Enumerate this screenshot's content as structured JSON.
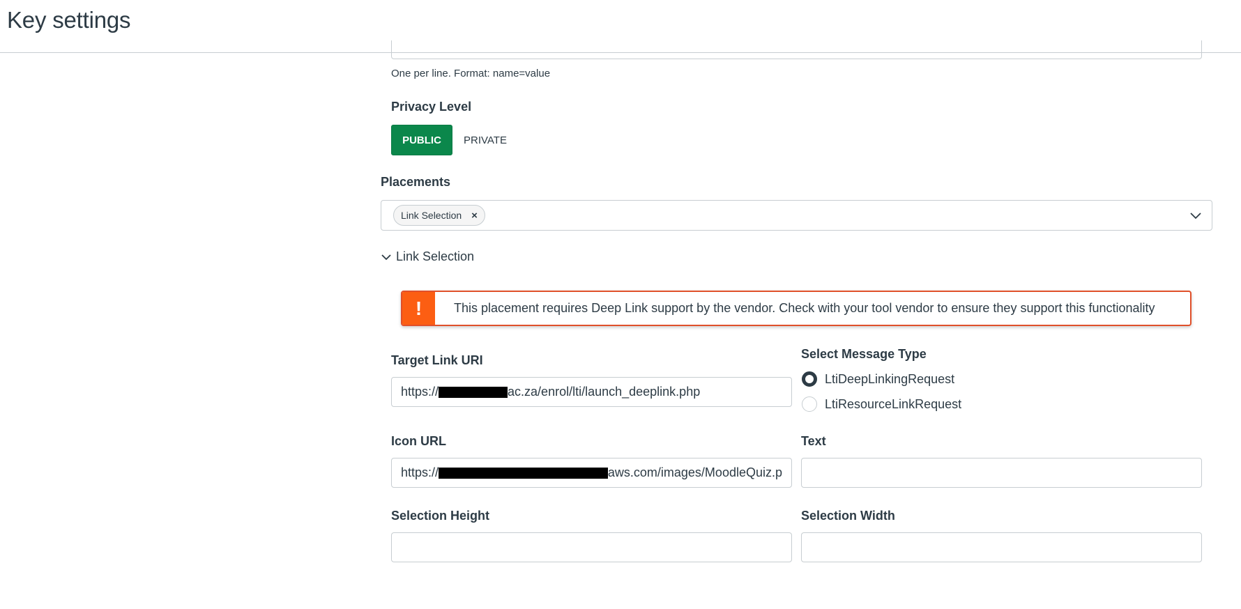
{
  "header": {
    "title": "Key settings"
  },
  "custom_fields": {
    "hint": "One per line. Format: name=value"
  },
  "privacy": {
    "label": "Privacy Level",
    "options": [
      "PUBLIC",
      "PRIVATE"
    ],
    "selected": "PUBLIC",
    "accent_color": "#0b874b"
  },
  "placements": {
    "label": "Placements",
    "tags": [
      "Link Selection"
    ],
    "remove_glyph": "×",
    "chevron_icon": "chevron-down-icon"
  },
  "section": {
    "title": "Link Selection",
    "alert": {
      "icon": "!",
      "text": "This placement requires Deep Link support by the vendor. Check with your tool vendor to ensure they support this functionality",
      "color": "#fc5e13"
    },
    "target_link_uri": {
      "label": "Target Link URI",
      "value_prefix": "https://",
      "value_suffix": "ac.za/enrol/lti/launch_deeplink.php"
    },
    "message_type": {
      "label": "Select Message Type",
      "options": [
        "LtiDeepLinkingRequest",
        "LtiResourceLinkRequest"
      ],
      "selected": "LtiDeepLinkingRequest"
    },
    "icon_url": {
      "label": "Icon URL",
      "value_prefix": "https://",
      "value_suffix": "aws.com/images/MoodleQuiz.p"
    },
    "text": {
      "label": "Text",
      "value": ""
    },
    "selection_height": {
      "label": "Selection Height",
      "value": ""
    },
    "selection_width": {
      "label": "Selection Width",
      "value": ""
    }
  }
}
